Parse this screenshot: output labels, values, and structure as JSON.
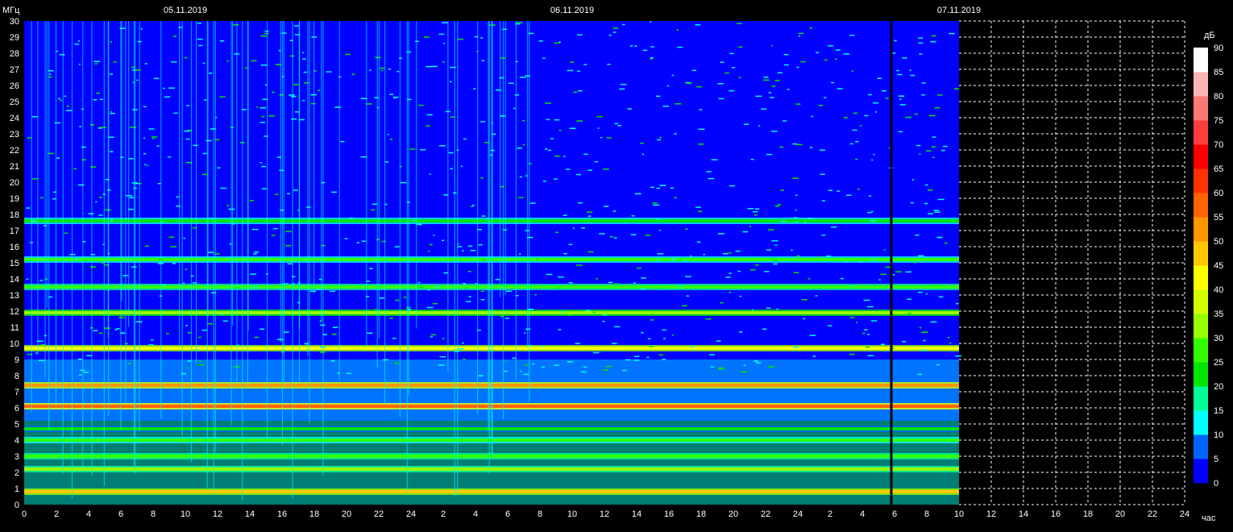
{
  "chart_data": {
    "type": "heatmap",
    "title": "",
    "ylabel": "МГц",
    "xlabel": "час",
    "colorbar_label": "дБ",
    "dates": [
      {
        "label": "05.11.2019",
        "hour": 0
      },
      {
        "label": "06.11.2019",
        "hour": 24
      },
      {
        "label": "07.11.2019",
        "hour": 48
      }
    ],
    "x_range_hours": [
      0,
      72
    ],
    "data_end_hour": 58,
    "gap_hour": 53.8,
    "ylim": [
      0,
      30
    ],
    "y_ticks": [
      0,
      1,
      2,
      3,
      4,
      5,
      6,
      7,
      8,
      9,
      10,
      11,
      12,
      13,
      14,
      15,
      16,
      17,
      18,
      19,
      20,
      21,
      22,
      23,
      24,
      25,
      26,
      27,
      28,
      29,
      30
    ],
    "x_tick_labels": [
      "0",
      "2",
      "4",
      "6",
      "8",
      "10",
      "12",
      "14",
      "16",
      "18",
      "20",
      "22",
      "24",
      "2",
      "4",
      "6",
      "8",
      "10",
      "12",
      "14",
      "16",
      "18",
      "20",
      "22",
      "24",
      "2",
      "4",
      "6",
      "8",
      "10",
      "12",
      "14",
      "16",
      "18",
      "20",
      "22",
      "24"
    ],
    "colorbar": {
      "ticks": [
        0,
        5,
        10,
        15,
        20,
        25,
        30,
        35,
        40,
        45,
        50,
        55,
        60,
        65,
        70,
        75,
        80,
        85,
        90
      ],
      "colors": [
        "#0000ff",
        "#0064ff",
        "#00ffff",
        "#00ff96",
        "#00e600",
        "#32ff00",
        "#96ff00",
        "#d2ff00",
        "#ffff00",
        "#ffc800",
        "#ff9600",
        "#ff6400",
        "#ff3200",
        "#ff0000",
        "#ff3c3c",
        "#ff7878",
        "#ffb4b4",
        "#ffffff"
      ]
    },
    "bands_mhz": [
      {
        "center": 0.8,
        "level_db": 45
      },
      {
        "center": 2.2,
        "level_db": 30
      },
      {
        "center": 3.0,
        "level_db": 28
      },
      {
        "center": 4.0,
        "level_db": 25
      },
      {
        "center": 4.7,
        "level_db": 20
      },
      {
        "center": 6.1,
        "level_db": 55
      },
      {
        "center": 7.4,
        "level_db": 50
      },
      {
        "center": 9.7,
        "level_db": 42
      },
      {
        "center": 11.9,
        "level_db": 32
      },
      {
        "center": 13.5,
        "level_db": 28
      },
      {
        "center": 15.2,
        "level_db": 25
      },
      {
        "center": 17.6,
        "level_db": 22
      }
    ]
  }
}
